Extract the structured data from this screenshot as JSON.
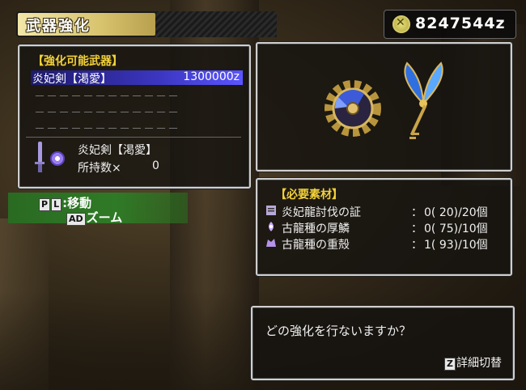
{
  "header": {
    "title": "武器強化"
  },
  "money": {
    "amount": "8247544z"
  },
  "weapon_list": {
    "heading": "【強化可能武器】",
    "selected_item": {
      "name": "炎妃剣【渇愛】",
      "cost": "1300000z"
    },
    "empty_slots": [
      "－－－－－－－－－－－－",
      "－－－－－－－－－－－－",
      "－－－－－－－－－－－－"
    ]
  },
  "selected_weapon": {
    "name": "炎妃剣【渇愛】",
    "owned_label": "所持数×",
    "owned_count": "0"
  },
  "controls": {
    "move": {
      "keys": [
        "P",
        "L"
      ],
      "label": "移動"
    },
    "zoom": {
      "keys": [
        "AD"
      ],
      "label": "ズーム"
    }
  },
  "materials": {
    "heading": "【必要素材】",
    "items": [
      {
        "name": "炎妃龍討伐の証",
        "colon": "：",
        "qty": "0( 20)/20個",
        "icon": "ticket-icon",
        "color": "#b8a8d8"
      },
      {
        "name": "古龍種の厚鱗",
        "colon": "：",
        "qty": "0( 75)/10個",
        "icon": "scale-icon",
        "color": "#c9a8ff"
      },
      {
        "name": "古龍種の重殻",
        "colon": "：",
        "qty": "1( 93)/10個",
        "icon": "shell-icon",
        "color": "#b493e8"
      }
    ]
  },
  "dialog": {
    "prompt": "どの強化を行ないますか？",
    "detail_key": "Z",
    "detail_label": "詳細切替"
  },
  "colors": {
    "heading": "#f2d13a",
    "selection": "#3b36c0",
    "controls_bg": "#2f7a26"
  }
}
